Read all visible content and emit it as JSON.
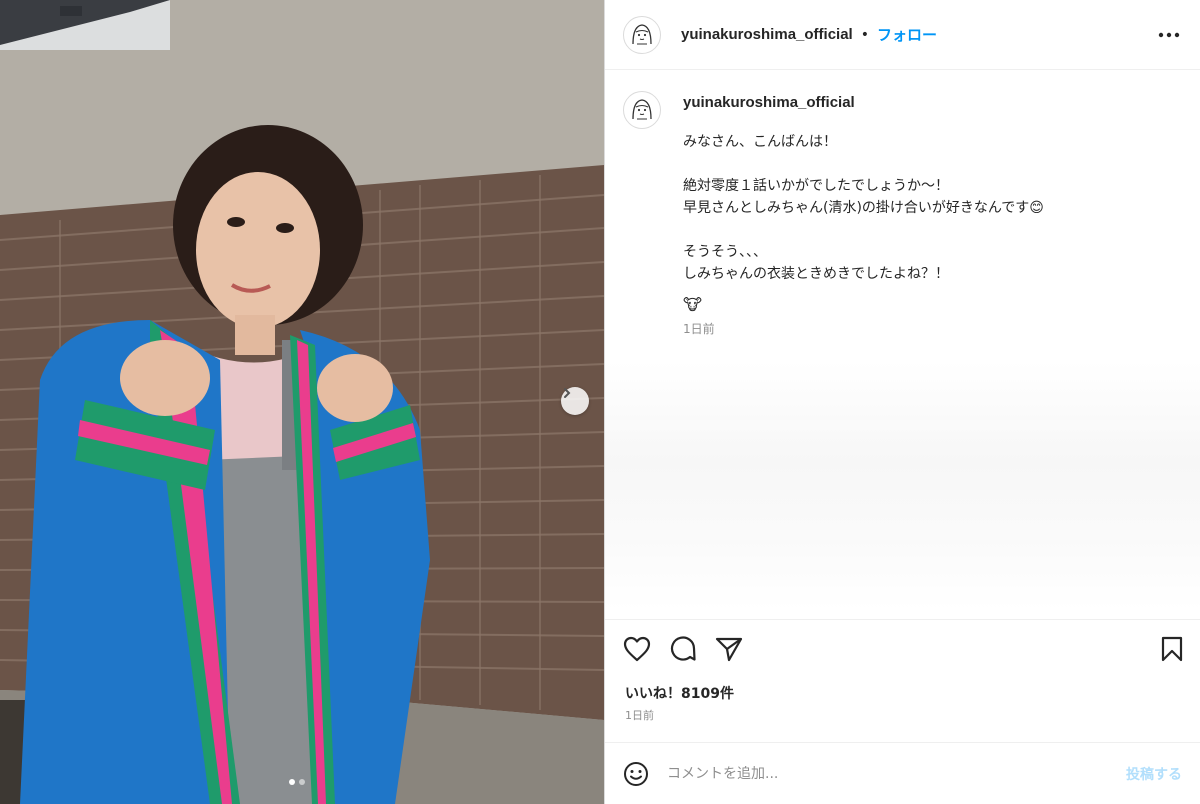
{
  "post": {
    "username": "yuinakuroshima_official",
    "separator": "•",
    "follow_label": "フォロー",
    "more_icon": "more-horizontal-icon",
    "caption_lines": [
      "みなさん、こんばんは！",
      "",
      "絶対零度１話いかがでしたでしょうか〜！",
      "早見さんとしみちゃん(清水)の掛け合いが好きなんです😊",
      "",
      "そうそう、、、",
      "しみちゃんの衣装ときめきでしたよね？！"
    ],
    "caption_emoji": "🐮",
    "caption_time": "1日前",
    "likes_text": "いいね！8109件",
    "post_time": "1日前"
  },
  "actions": {
    "like_icon": "heart-icon",
    "comment_icon": "comment-icon",
    "share_icon": "paper-plane-icon",
    "save_icon": "bookmark-icon"
  },
  "comment": {
    "placeholder": "コメントを追加...",
    "post_label": "投稿する",
    "emoji_icon": "smiley-icon"
  },
  "carousel": {
    "current_index": 1,
    "total": 2
  },
  "colors": {
    "accent": "#0095f6",
    "post_disabled": "#b2dffc",
    "muted": "#8e8e8e",
    "text": "#262626"
  }
}
